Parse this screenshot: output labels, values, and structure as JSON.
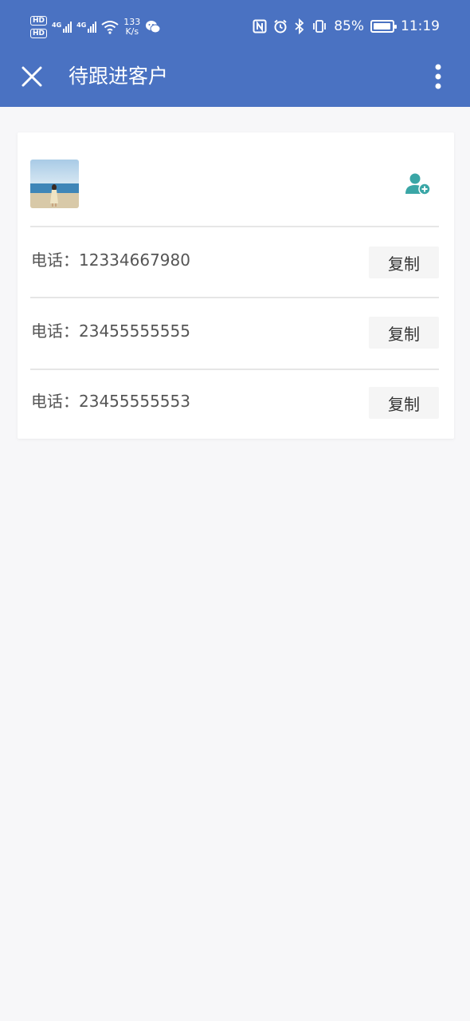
{
  "status_bar": {
    "hd_top": "HD",
    "hd_bottom": "HD",
    "network_1": "4G",
    "network_2": "4G",
    "speed_value": "133",
    "speed_unit": "K/s",
    "battery": "85%",
    "time": "11:19"
  },
  "app_bar": {
    "title": "待跟进客户"
  },
  "card": {
    "rows": [
      {
        "label": "电话：12334667980",
        "copy_label": "复制"
      },
      {
        "label": "电话：23455555555",
        "copy_label": "复制"
      },
      {
        "label": "电话：23455555553",
        "copy_label": "复制"
      }
    ]
  },
  "colors": {
    "primary": "#4a72c2",
    "accent_teal": "#3aa6a6",
    "background": "#f7f7f9"
  },
  "icons": [
    "close-icon",
    "more-vert-icon",
    "add-contact-icon",
    "wechat-icon",
    "nfc-icon",
    "alarm-icon",
    "bluetooth-icon",
    "vibrate-icon",
    "wifi-icon",
    "battery-icon"
  ]
}
